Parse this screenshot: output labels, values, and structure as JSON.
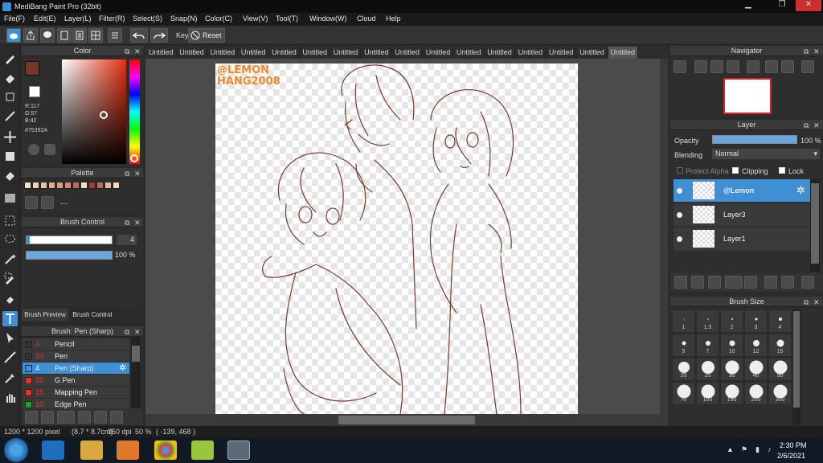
{
  "window": {
    "title": "MediBang Paint Pro (32bit)",
    "min": "▁",
    "max": "❐",
    "close": "✕"
  },
  "menu": [
    "File(F)",
    "Edit(E)",
    "Layer(L)",
    "Filter(R)",
    "Select(S)",
    "Snap(N)",
    "Color(C)",
    "View(V)",
    "Tool(T)",
    "Window(W)",
    "Cloud",
    "Help"
  ],
  "toolbar": {
    "key_label": "Key",
    "reset_label": "Reset"
  },
  "color_panel": {
    "title": "Color",
    "r": "R:117",
    "g": "G:57",
    "b": "B:42",
    "hex": "#75392A",
    "primary": "#75392A",
    "secondary": "#ffffff"
  },
  "palette_panel": {
    "title": "Palette",
    "dashes": "---",
    "swatches": [
      "#f6e0c8",
      "#f3d2b8",
      "#eec1a4",
      "#e8ae8c",
      "#e59c74",
      "#d8866b",
      "#c8694f",
      "#f5ddc6",
      "#a13c30",
      "#c66a4f",
      "#e9b996",
      "#f7d9b9"
    ]
  },
  "brush_control_top": {
    "title": "Brush Control",
    "size": "4",
    "opacity": "100 %"
  },
  "brush_tabs": {
    "preview": "Brush Preview",
    "control": "Brush Control"
  },
  "brush_list": {
    "title": "Brush: Pen (Sharp)",
    "items": [
      {
        "size": "4",
        "name": "Pencil",
        "color": "#333333"
      },
      {
        "size": "10",
        "name": "Pen",
        "color": "#333333"
      },
      {
        "size": "4",
        "name": "Pen (Sharp)",
        "color": "#3f8fd5"
      },
      {
        "size": "15",
        "name": "G Pen",
        "color": "#e03030"
      },
      {
        "size": "15",
        "name": "Mapping Pen",
        "color": "#e03030"
      },
      {
        "size": "10",
        "name": "Edge Pen",
        "color": "#20a020"
      }
    ]
  },
  "tabs": [
    "Untitled",
    "Untitled",
    "Untitled",
    "Untitled",
    "Untitled",
    "Untitled",
    "Untitled",
    "Untitled",
    "Untitled",
    "Untitled",
    "Untitled",
    "Untitled",
    "Untitled",
    "Untitled",
    "Untitled",
    "Untitled"
  ],
  "canvas": {
    "watermark_line1": "@LEMON",
    "watermark_line2": "HANG2008",
    "line_color": "#7a3a2a"
  },
  "navigator": {
    "title": "Navigator"
  },
  "layer_panel": {
    "title": "Layer",
    "opacity_label": "Opacity",
    "opacity_value": "100 %",
    "blending_label": "Blending",
    "blending_value": "Normal",
    "protect_alpha": "Protect Alpha",
    "clipping": "Clipping",
    "lock": "Lock",
    "layers": [
      {
        "name": "@Lemon",
        "selected": true
      },
      {
        "name": "Layer3",
        "selected": false
      },
      {
        "name": "Layer1",
        "selected": false
      }
    ]
  },
  "brush_size": {
    "title": "Brush Size",
    "sizes": [
      "1",
      "1.5",
      "2",
      "3",
      "4",
      "5",
      "7",
      "10",
      "12",
      "15",
      "20",
      "25",
      "30",
      "40",
      "50",
      "70",
      "100",
      "150",
      "200",
      "300"
    ]
  },
  "status": {
    "dimensions": "1200 * 1200 pixel",
    "physical": "(8.7 * 8.7cm)",
    "dpi": "350 dpi",
    "zoom": "50 %",
    "coords": "( -139, 468 )"
  },
  "taskbar": {
    "time": "2:30 PM",
    "date": "2/6/2021"
  }
}
